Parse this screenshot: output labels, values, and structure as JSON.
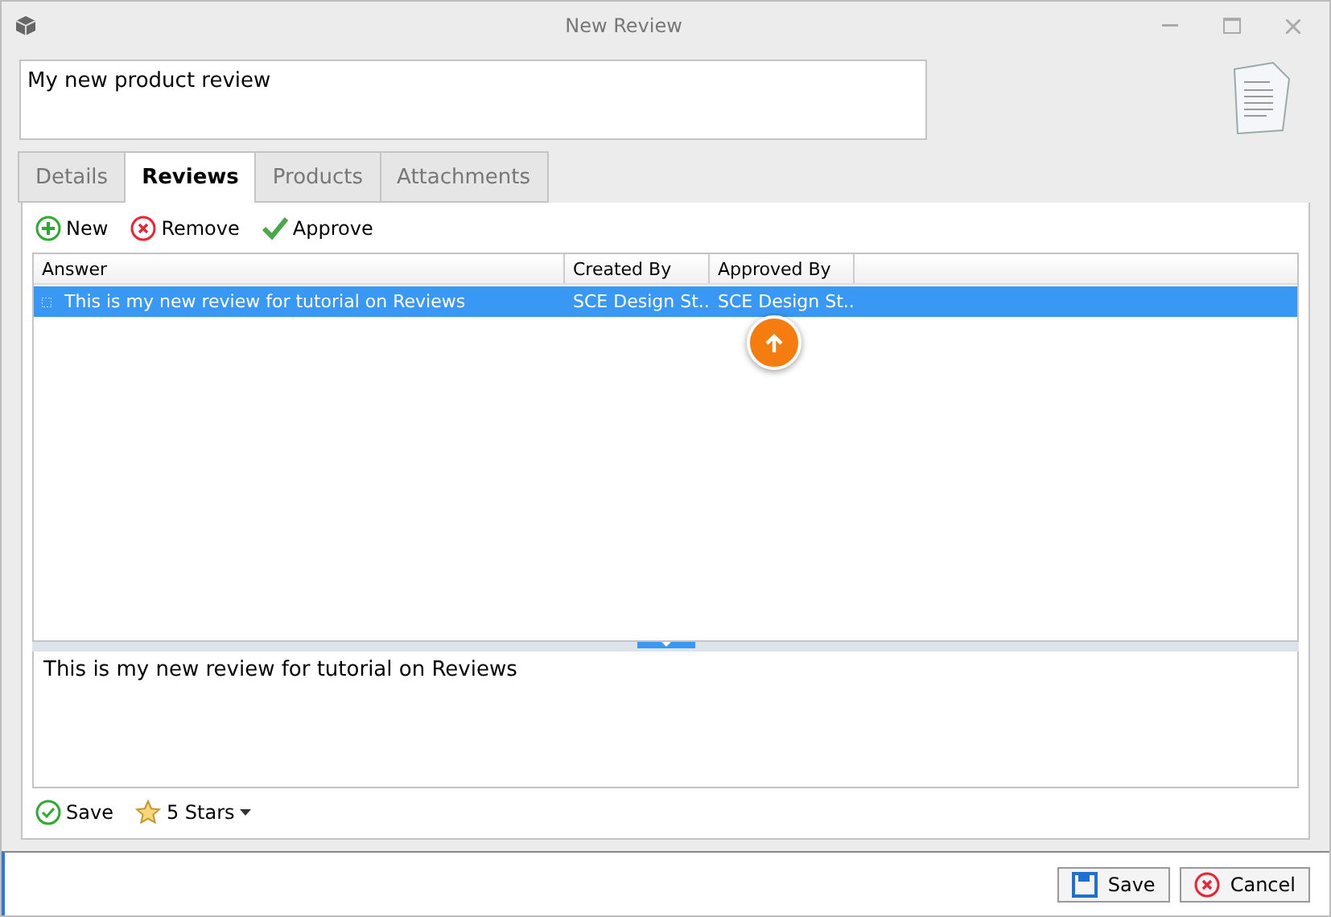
{
  "window": {
    "title": "New Review"
  },
  "title_field": {
    "value": "My new product review"
  },
  "tabs": [
    {
      "label": "Details",
      "selected": false
    },
    {
      "label": "Reviews",
      "selected": true
    },
    {
      "label": "Products",
      "selected": false
    },
    {
      "label": "Attachments",
      "selected": false
    }
  ],
  "toolbar": [
    {
      "kind": "add",
      "label": "New"
    },
    {
      "kind": "remove",
      "label": "Remove"
    },
    {
      "kind": "approve",
      "label": "Approve"
    }
  ],
  "table": {
    "columns": [
      "Answer",
      "Created By",
      "Approved By"
    ],
    "rows": [
      {
        "selected": true,
        "cells": [
          "This is my new review for tutorial on Reviews",
          "SCE Design St..",
          "SCE Design St.."
        ]
      }
    ]
  },
  "editor": {
    "value": "This is my new review for tutorial on Reviews"
  },
  "bottom_toolbar": {
    "save": "Save",
    "rating": "5 Stars"
  },
  "footer_buttons": [
    {
      "kind": "save",
      "label": "Save"
    },
    {
      "kind": "cancel",
      "label": "Cancel"
    }
  ]
}
